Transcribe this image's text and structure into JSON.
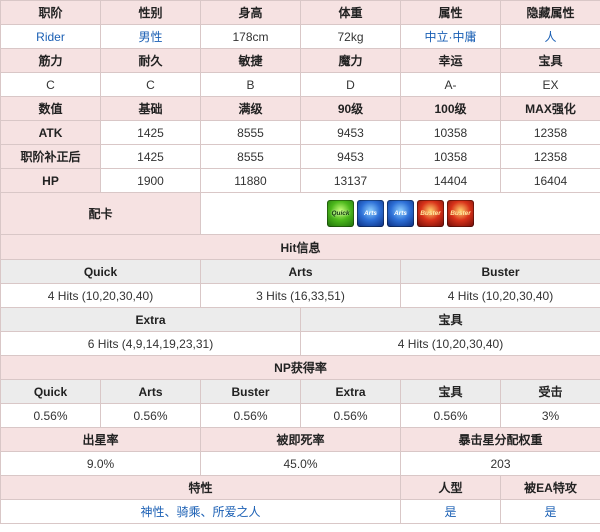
{
  "row1": {
    "headers": [
      "职阶",
      "性别",
      "身高",
      "体重",
      "属性",
      "隐藏属性"
    ],
    "values": [
      "Rider",
      "男性",
      "178cm",
      "72kg",
      "中立·中庸",
      "人"
    ]
  },
  "row2": {
    "headers": [
      "筋力",
      "耐久",
      "敏捷",
      "魔力",
      "幸运",
      "宝具"
    ],
    "values": [
      "C",
      "C",
      "B",
      "D",
      "A-",
      "EX"
    ]
  },
  "stats": {
    "headers": [
      "数值",
      "基础",
      "满级",
      "90级",
      "100级",
      "MAX强化"
    ],
    "rows": [
      {
        "label": "ATK",
        "values": [
          "1425",
          "8555",
          "9453",
          "10358",
          "12358"
        ]
      },
      {
        "label": "职阶补正后",
        "values": [
          "1425",
          "8555",
          "9453",
          "10358",
          "12358"
        ]
      },
      {
        "label": "HP",
        "values": [
          "1900",
          "11880",
          "13137",
          "14404",
          "16404"
        ]
      }
    ]
  },
  "deck": {
    "label": "配卡",
    "cards": [
      {
        "type": "quick",
        "text": "Quick",
        "icon": "quick-card-icon"
      },
      {
        "type": "arts",
        "text": "Arts",
        "icon": "arts-card-icon"
      },
      {
        "type": "arts",
        "text": "Arts",
        "icon": "arts-card-icon"
      },
      {
        "type": "buster",
        "text": "Buster",
        "icon": "buster-card-icon"
      },
      {
        "type": "buster",
        "text": "Buster",
        "icon": "buster-card-icon"
      }
    ]
  },
  "hits": {
    "title": "Hit信息",
    "headers1": [
      "Quick",
      "Arts",
      "Buster"
    ],
    "values1": [
      "4 Hits (10,20,30,40)",
      "3 Hits (16,33,51)",
      "4 Hits (10,20,30,40)"
    ],
    "headers2": [
      "Extra",
      "宝具"
    ],
    "values2": [
      "6 Hits (4,9,14,19,23,31)",
      "4 Hits (10,20,30,40)"
    ]
  },
  "np": {
    "title": "NP获得率",
    "headers": [
      "Quick",
      "Arts",
      "Buster",
      "Extra",
      "宝具",
      "受击"
    ],
    "values": [
      "0.56%",
      "0.56%",
      "0.56%",
      "0.56%",
      "0.56%",
      "3%"
    ]
  },
  "star": {
    "headers": [
      "出星率",
      "被即死率",
      "暴击星分配权重"
    ],
    "values": [
      "9.0%",
      "45.0%",
      "203"
    ]
  },
  "traits": {
    "headers": [
      "特性",
      "人型",
      "被EA特攻"
    ],
    "trait_values": [
      "神性",
      "骑乘",
      "所爱之人"
    ],
    "separator": "、",
    "humanoid": "是",
    "ea": "是"
  },
  "colors": {
    "header_pink": "#f6e2e2",
    "header_gray": "#ececec",
    "link_blue": "#1a5fb4",
    "border": "#d9c7c7"
  }
}
